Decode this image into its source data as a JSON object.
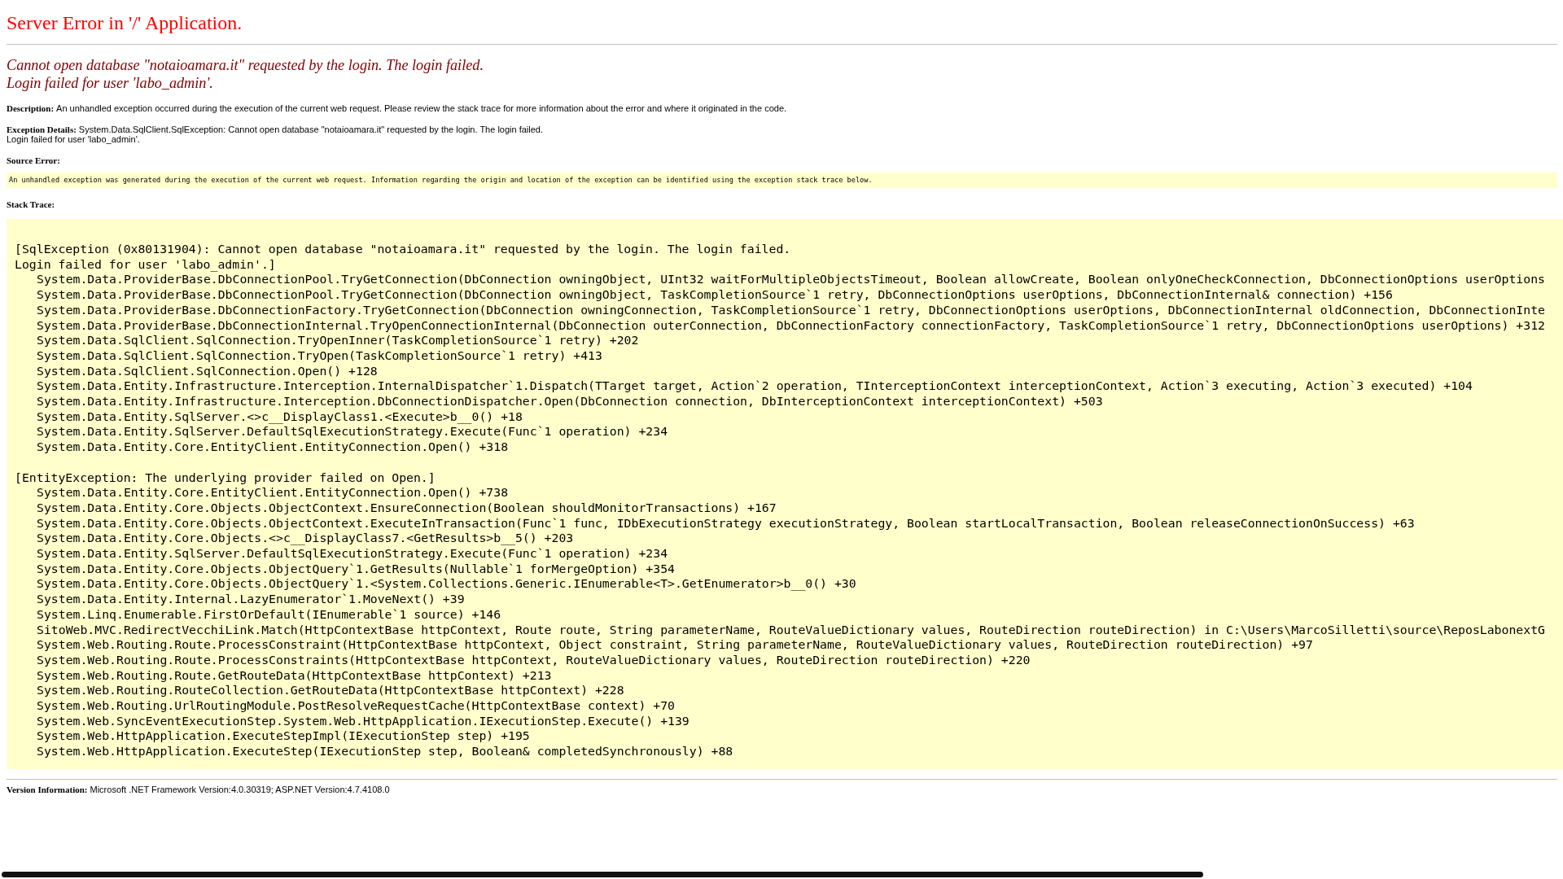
{
  "title": "Server Error in '/' Application.",
  "error_message": [
    "Cannot open database \"notaioamara.it\" requested by the login. The login failed.",
    "Login failed for user 'labo_admin'."
  ],
  "description": {
    "label": "Description:",
    "text": "An unhandled exception occurred during the execution of the current web request. Please review the stack trace for more information about the error and where it originated in the code."
  },
  "exception_details": {
    "label": "Exception Details:",
    "lines": [
      "System.Data.SqlClient.SqlException: Cannot open database \"notaioamara.it\" requested by the login. The login failed.",
      "Login failed for user 'labo_admin'."
    ]
  },
  "source_error": {
    "label": "Source Error:",
    "text": "An unhandled exception was generated during the execution of the current web request. Information regarding the origin and location of the exception can be identified using the exception stack trace below."
  },
  "stack_trace": {
    "label": "Stack Trace:",
    "blocks": [
      {
        "header": [
          "[SqlException (0x80131904): Cannot open database \"notaioamara.it\" requested by the login. The login failed.",
          "Login failed for user 'labo_admin'.]"
        ],
        "frames": [
          "System.Data.ProviderBase.DbConnectionPool.TryGetConnection(DbConnection owningObject, UInt32 waitForMultipleObjectsTimeout, Boolean allowCreate, Boolean onlyOneCheckConnection, DbConnectionOptions userOptions",
          "System.Data.ProviderBase.DbConnectionPool.TryGetConnection(DbConnection owningObject, TaskCompletionSource`1 retry, DbConnectionOptions userOptions, DbConnectionInternal& connection) +156",
          "System.Data.ProviderBase.DbConnectionFactory.TryGetConnection(DbConnection owningConnection, TaskCompletionSource`1 retry, DbConnectionOptions userOptions, DbConnectionInternal oldConnection, DbConnectionInte",
          "System.Data.ProviderBase.DbConnectionInternal.TryOpenConnectionInternal(DbConnection outerConnection, DbConnectionFactory connectionFactory, TaskCompletionSource`1 retry, DbConnectionOptions userOptions) +312",
          "System.Data.SqlClient.SqlConnection.TryOpenInner(TaskCompletionSource`1 retry) +202",
          "System.Data.SqlClient.SqlConnection.TryOpen(TaskCompletionSource`1 retry) +413",
          "System.Data.SqlClient.SqlConnection.Open() +128",
          "System.Data.Entity.Infrastructure.Interception.InternalDispatcher`1.Dispatch(TTarget target, Action`2 operation, TInterceptionContext interceptionContext, Action`3 executing, Action`3 executed) +104",
          "System.Data.Entity.Infrastructure.Interception.DbConnectionDispatcher.Open(DbConnection connection, DbInterceptionContext interceptionContext) +503",
          "System.Data.Entity.SqlServer.<>c__DisplayClass1.<Execute>b__0() +18",
          "System.Data.Entity.SqlServer.DefaultSqlExecutionStrategy.Execute(Func`1 operation) +234",
          "System.Data.Entity.Core.EntityClient.EntityConnection.Open() +318"
        ]
      },
      {
        "header": [
          "[EntityException: The underlying provider failed on Open.]"
        ],
        "frames": [
          "System.Data.Entity.Core.EntityClient.EntityConnection.Open() +738",
          "System.Data.Entity.Core.Objects.ObjectContext.EnsureConnection(Boolean shouldMonitorTransactions) +167",
          "System.Data.Entity.Core.Objects.ObjectContext.ExecuteInTransaction(Func`1 func, IDbExecutionStrategy executionStrategy, Boolean startLocalTransaction, Boolean releaseConnectionOnSuccess) +63",
          "System.Data.Entity.Core.Objects.<>c__DisplayClass7.<GetResults>b__5() +203",
          "System.Data.Entity.SqlServer.DefaultSqlExecutionStrategy.Execute(Func`1 operation) +234",
          "System.Data.Entity.Core.Objects.ObjectQuery`1.GetResults(Nullable`1 forMergeOption) +354",
          "System.Data.Entity.Core.Objects.ObjectQuery`1.<System.Collections.Generic.IEnumerable<T>.GetEnumerator>b__0() +30",
          "System.Data.Entity.Internal.LazyEnumerator`1.MoveNext() +39",
          "System.Linq.Enumerable.FirstOrDefault(IEnumerable`1 source) +146",
          "SitoWeb.MVC.RedirectVecchiLink.Match(HttpContextBase httpContext, Route route, String parameterName, RouteValueDictionary values, RouteDirection routeDirection) in C:\\Users\\MarcoSilletti\\source\\ReposLabonextG",
          "System.Web.Routing.Route.ProcessConstraint(HttpContextBase httpContext, Object constraint, String parameterName, RouteValueDictionary values, RouteDirection routeDirection) +97",
          "System.Web.Routing.Route.ProcessConstraints(HttpContextBase httpContext, RouteValueDictionary values, RouteDirection routeDirection) +220",
          "System.Web.Routing.Route.GetRouteData(HttpContextBase httpContext) +213",
          "System.Web.Routing.RouteCollection.GetRouteData(HttpContextBase httpContext) +228",
          "System.Web.Routing.UrlRoutingModule.PostResolveRequestCache(HttpContextBase context) +70",
          "System.Web.SyncEventExecutionStep.System.Web.HttpApplication.IExecutionStep.Execute() +139",
          "System.Web.HttpApplication.ExecuteStepImpl(IExecutionStep step) +195",
          "System.Web.HttpApplication.ExecuteStep(IExecutionStep step, Boolean& completedSynchronously) +88"
        ]
      }
    ]
  },
  "version_information": {
    "label": "Version Information:",
    "text": "Microsoft .NET Framework Version:4.0.30319; ASP.NET Version:4.7.4108.0"
  }
}
